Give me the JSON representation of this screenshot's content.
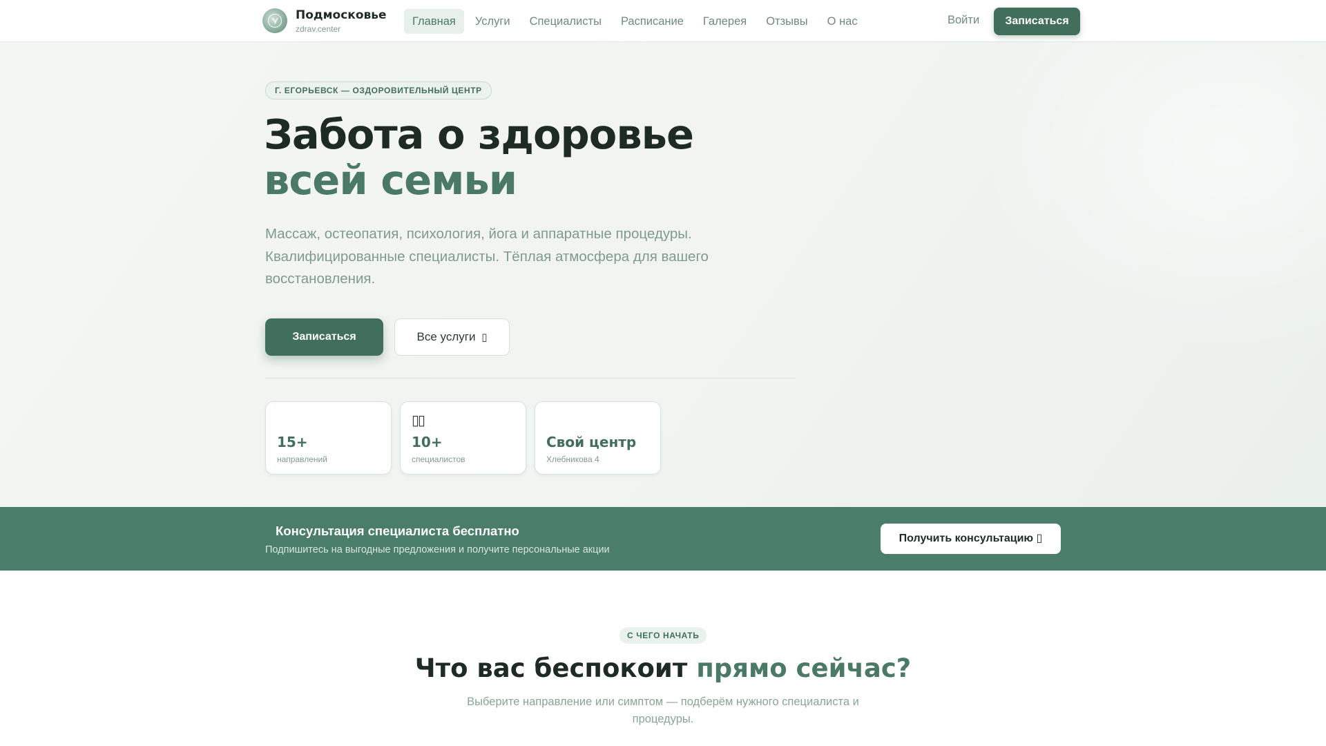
{
  "header": {
    "brand_name": "Подмосковье",
    "brand_domain": "zdrav.center",
    "nav": [
      {
        "label": "Главная",
        "active": true
      },
      {
        "label": "Услуги",
        "active": false
      },
      {
        "label": "Специалисты",
        "active": false
      },
      {
        "label": "Расписание",
        "active": false
      },
      {
        "label": "Галерея",
        "active": false
      },
      {
        "label": "Отзывы",
        "active": false
      },
      {
        "label": "О нас",
        "active": false
      }
    ],
    "login_label": "Войти",
    "cta_label": "Записаться"
  },
  "hero": {
    "badge": "Г. ЕГОРЬЕВСК — ОЗДОРОВИТЕЛЬНЫЙ ЦЕНТР",
    "title_line1": "Забота о здоровье",
    "title_line2": "всей семьи",
    "description": "Массаж, остеопатия, психология, йога и аппаратные процедуры. Квалифицированные специалисты. Тёплая атмосфера для вашего восстановления.",
    "primary_button": "Записаться",
    "secondary_button": "Все услуги",
    "secondary_button_icon": "▯",
    "stats": [
      {
        "icon": "",
        "value": "15+",
        "label": "направлений"
      },
      {
        "icon": "▯▯",
        "value": "10+",
        "label": "специалистов"
      },
      {
        "icon": "",
        "value": "Свой центр",
        "label": "Хлебникова 4"
      }
    ]
  },
  "promo": {
    "title": "Консультация специалиста бесплатно",
    "subtitle": "Подпишитесь на выгодные предложения и получите персональные акции",
    "button_label": "Получить консультацию",
    "button_icon": "▯"
  },
  "section": {
    "badge": "С ЧЕГО НАЧАТЬ",
    "title_part1": "Что вас беспокоит ",
    "title_accent": "прямо сейчас?",
    "description": "Выберите направление или симптом — подберём нужного специалиста и процедуры."
  },
  "colors": {
    "brand_green": "#426e5c",
    "accent_green": "#4a7a66",
    "promo_band": "#4a7d6a",
    "muted_text": "#7f9b8c",
    "hero_bg": "#f2f5f2"
  },
  "icons": {
    "logo": "leaf-logo-icon",
    "promo": "gift-icon",
    "secondary_button": "arrow-right-icon"
  }
}
